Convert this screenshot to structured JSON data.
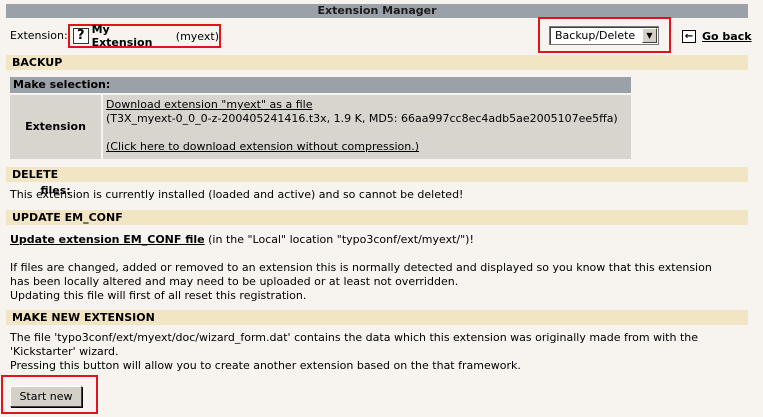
{
  "window": {
    "title": "Extension Manager"
  },
  "extension": {
    "label": "Extension:",
    "icon": "question-icon",
    "title": "My Extension",
    "key": "(myext)"
  },
  "menu": {
    "selected": "Backup/Delete"
  },
  "back": {
    "label": "Go back"
  },
  "backup": {
    "header": "BACKUP",
    "make_selection": "Make selection:",
    "files_label": "Extension files:",
    "download_link": "Download extension \"myext\" as a file",
    "file_info": "(T3X_myext-0_0_0-z-200405241416.t3x, 1.9 K, MD5: 66aa997cc8ec4adb5ae2005107ee5ffa)",
    "nocompress_link": "(Click here to download extension without compression.)"
  },
  "delete": {
    "header": "DELETE",
    "text": "This extension is currently installed (loaded and active) and so cannot be deleted!"
  },
  "update": {
    "header": "UPDATE EM_CONF",
    "link": "Update extension EM_CONF file",
    "link_suffix": " (in the \"Local\" location \"typo3conf/ext/myext/\")!",
    "para1": "If files are changed, added or removed to an extension this is normally detected and displayed so you know that this extension",
    "para2": "has been locally altered and may need to be uploaded or at least not overridden.",
    "para3": "Updating this file will first of all reset this registration."
  },
  "make_new": {
    "header": "MAKE NEW EXTENSION",
    "line1": "The file 'typo3conf/ext/myext/doc/wizard_form.dat' contains the data which this extension was originally made from with the",
    "line2": "'Kickstarter' wizard.",
    "line3": "Pressing this button will allow you to create another extension based on the that framework.",
    "button": "Start new"
  }
}
